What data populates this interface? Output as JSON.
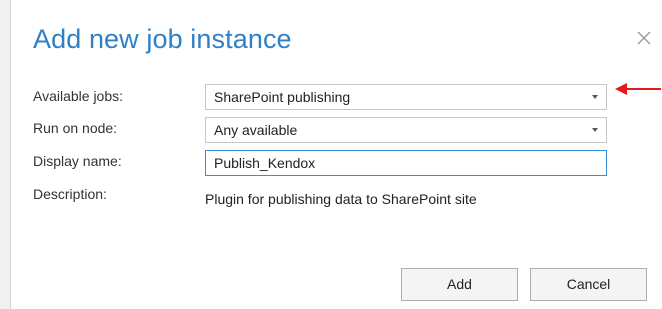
{
  "dialog": {
    "title": "Add new job instance",
    "close_icon": "close-icon"
  },
  "form": {
    "available_jobs": {
      "label": "Available jobs:",
      "value": "SharePoint publishing"
    },
    "run_on_node": {
      "label": "Run on node:",
      "value": "Any available"
    },
    "display_name": {
      "label": "Display name:",
      "value": "Publish_Kendox"
    },
    "description": {
      "label": "Description:",
      "value": "Plugin for publishing data to SharePoint site"
    }
  },
  "buttons": {
    "add_label": "Add",
    "cancel_label": "Cancel"
  },
  "annotation": {
    "arrow_color": "#e3191b",
    "arrow_icon": "red-arrow-icon"
  },
  "colors": {
    "title": "#2f80c6",
    "focus_border": "#3b8fd9"
  }
}
